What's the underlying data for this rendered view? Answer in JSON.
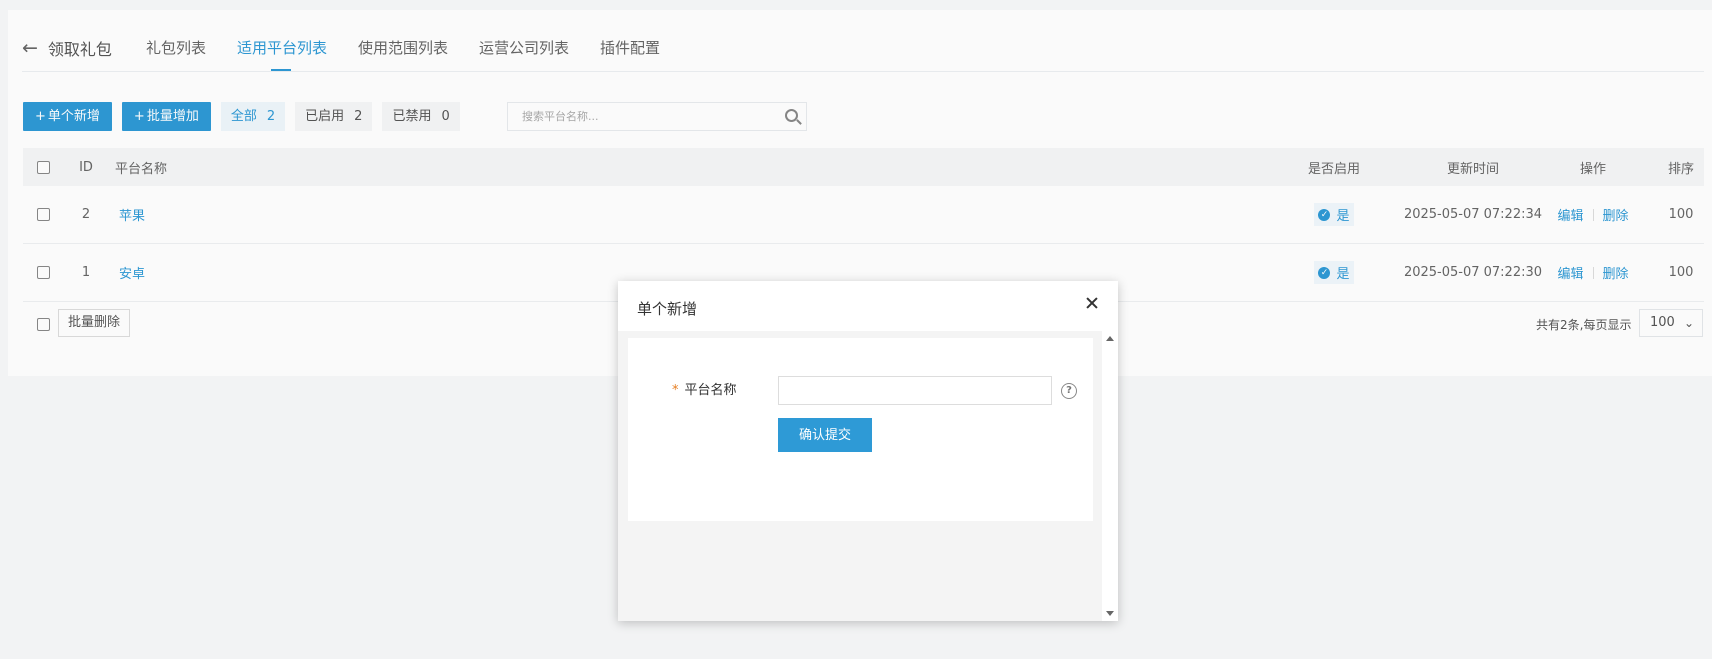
{
  "tabs": {
    "back_label": "领取礼包",
    "items": [
      {
        "label": "礼包列表"
      },
      {
        "label": "适用平台列表"
      },
      {
        "label": "使用范围列表"
      },
      {
        "label": "运营公司列表"
      },
      {
        "label": "插件配置"
      }
    ]
  },
  "toolbar": {
    "add_single": "单个新增",
    "add_batch": "批量增加",
    "filters": [
      {
        "label": "全部",
        "count": "2"
      },
      {
        "label": "已启用",
        "count": "2"
      },
      {
        "label": "已禁用",
        "count": "0"
      }
    ],
    "search_placeholder": "搜索平台名称..."
  },
  "table": {
    "headers": {
      "id": "ID",
      "name": "平台名称",
      "enabled": "是否启用",
      "time": "更新时间",
      "op": "操作",
      "sort": "排序"
    },
    "rows": [
      {
        "id": "2",
        "name": "苹果",
        "enabled": "是",
        "time": "2025-05-07 07:22:34",
        "edit": "编辑",
        "delete": "删除",
        "sort": "100"
      },
      {
        "id": "1",
        "name": "安卓",
        "enabled": "是",
        "time": "2025-05-07 07:22:30",
        "edit": "编辑",
        "delete": "删除",
        "sort": "100"
      }
    ],
    "footer": {
      "batch_delete": "批量删除",
      "summary": "共有2条,每页显示",
      "page_size": "100"
    }
  },
  "modal": {
    "title": "单个新增",
    "field_required_mark": "*",
    "field_label": "平台名称",
    "field_value": "",
    "help": "?",
    "submit": "确认提交"
  },
  "colors": {
    "accent": "#2e9ad6",
    "required": "#e67e22"
  }
}
